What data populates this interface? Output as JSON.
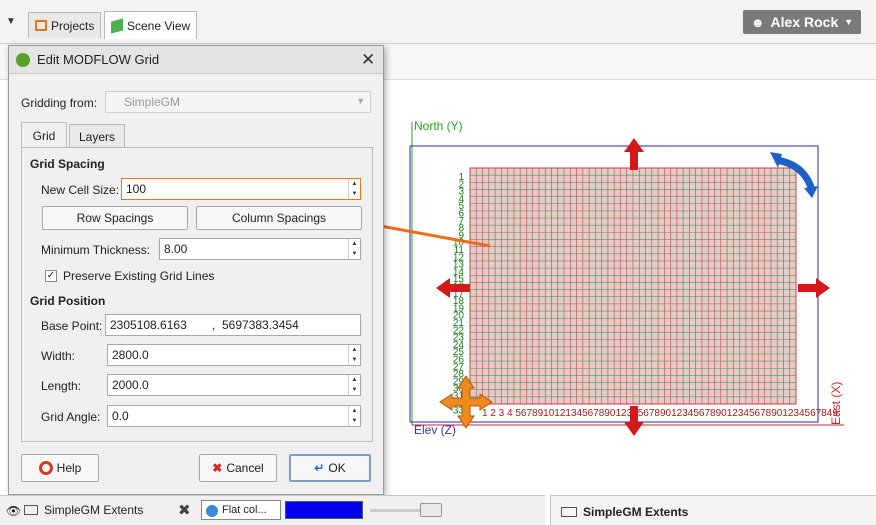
{
  "tabs": {
    "projects": "Projects",
    "scene_view": "Scene View"
  },
  "user": {
    "name": "Alex Rock"
  },
  "dialog": {
    "title": "Edit MODFLOW Grid",
    "gridding_from_label": "Gridding from:",
    "gridding_from_value": "SimpleGM",
    "tabs": [
      "Grid",
      "Layers"
    ],
    "grid_spacing_heading": "Grid Spacing",
    "new_cell_size_label": "New Cell Size:",
    "new_cell_size_value": "100",
    "row_spacings_button": "Row Spacings",
    "column_spacings_button": "Column Spacings",
    "minimum_thickness_label": "Minimum Thickness:",
    "minimum_thickness_value": "8.00",
    "preserve_label": "Preserve Existing Grid Lines",
    "grid_position_heading": "Grid Position",
    "base_point_label": "Base Point:",
    "base_point_x": "2305108.6163",
    "base_point_sep": ",",
    "base_point_y": "5697383.3454",
    "width_label": "Width:",
    "width_value": "2800.0",
    "length_label": "Length:",
    "length_value": "2000.0",
    "grid_angle_label": "Grid Angle:",
    "grid_angle_value": "0.0",
    "help_button": "Help",
    "cancel_button": "Cancel",
    "ok_button": "OK"
  },
  "scene": {
    "north_label": "North (Y)",
    "east_label": "East (X)",
    "elev_label": "Elev (Z)",
    "row_numbers": [
      "1",
      "2",
      "3",
      "4",
      "5",
      "6",
      "7",
      "8",
      "9",
      "10",
      "11",
      "12",
      "13",
      "14",
      "15",
      "16",
      "17",
      "18",
      "19",
      "20",
      "21",
      "22",
      "23",
      "24",
      "25",
      "26",
      "27",
      "28",
      "29",
      "30",
      "31",
      "32",
      "33"
    ],
    "column_numbers_text": "1 2 3 4 5678910121345678901234567890123456789012345678901234567849",
    "grid_rows": 33,
    "grid_cols": 52,
    "colors": {
      "grid_fill": "#e8c9c9",
      "row_line": "#3aa84a",
      "col_line": "#c84040",
      "bounds": "#2a2aa0",
      "arrow_red": "#d21a1a",
      "arrow_orange": "#f08a1c",
      "arrow_blue": "#1e5fc8",
      "callout": "#f26a1b"
    }
  },
  "bottom": {
    "object_name": "SimpleGM Extents",
    "color_mode": "Flat col...",
    "swatch_color": "#0000ee",
    "right_title": "SimpleGM Extents"
  }
}
